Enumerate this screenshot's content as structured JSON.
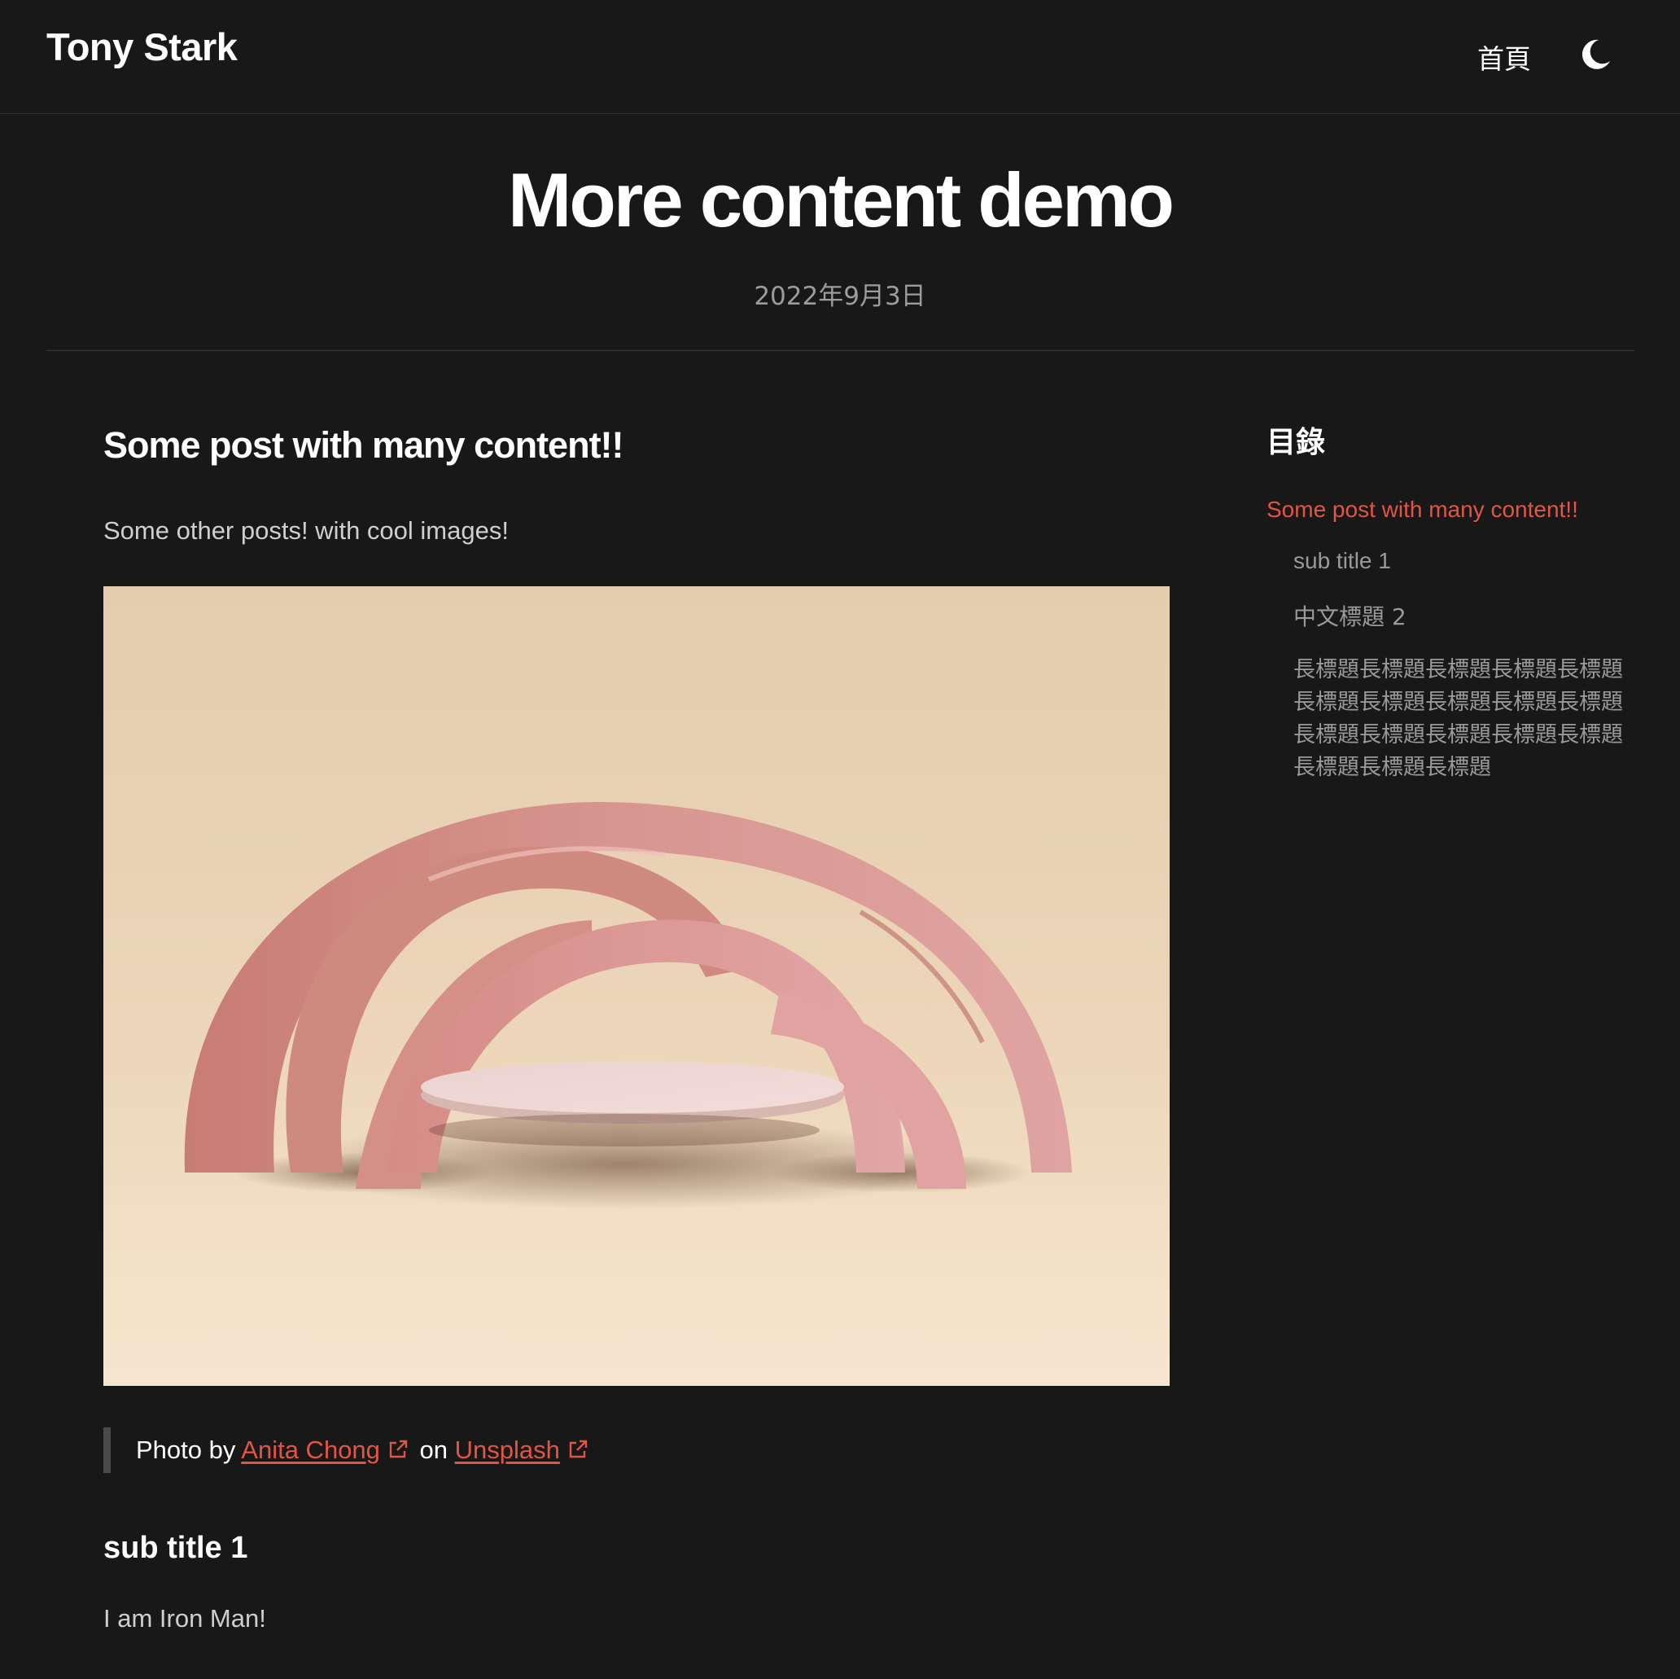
{
  "header": {
    "site_title": "Tony Stark",
    "nav_home": "首頁",
    "theme_icon": "moon-icon"
  },
  "post": {
    "title": "More content demo",
    "date": "2022年9月3日"
  },
  "article": {
    "heading": "Some post with many content!!",
    "intro": "Some other posts! with cool images!",
    "image_subject": "pink arches with round platform",
    "caption": {
      "prefix": "Photo by",
      "author": "Anita Chong",
      "middle": "on",
      "source": "Unsplash"
    },
    "subtitle": "sub title 1",
    "subtitle_text": "I am Iron Man!"
  },
  "toc": {
    "heading": "目錄",
    "items": [
      {
        "label": "Some post with many content!!"
      },
      {
        "label": "sub title 1"
      },
      {
        "label": "中文標題 2"
      },
      {
        "label": "長標題長標題長標題長標題長標題長標題長標題長標題長標題長標題長標題長標題長標題長標題長標題長標題長標題長標題"
      }
    ]
  },
  "colors": {
    "background": "#181818",
    "accent": "#e25545",
    "muted": "#9a9a9a"
  }
}
